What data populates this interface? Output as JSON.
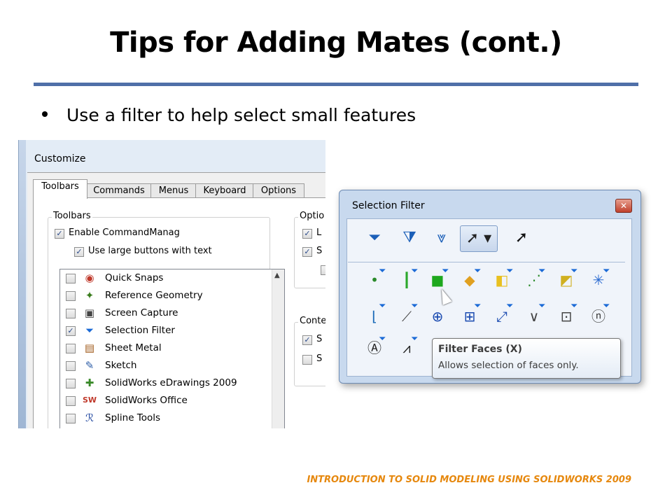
{
  "slide": {
    "title": "Tips for Adding Mates (cont.)",
    "bullet": "Use a filter to help select small features",
    "footer": "INTRODUCTION TO SOLID MODELING USING SOLIDWORKS 2009"
  },
  "customize": {
    "title": "Customize",
    "tabs": [
      "Toolbars",
      "Commands",
      "Menus",
      "Keyboard",
      "Options"
    ],
    "toolbars_group": {
      "label": "Toolbars",
      "enable_command_manager": "Enable CommandManag",
      "use_large_buttons": "Use large buttons with text"
    },
    "options_group_label": "Optio",
    "context_group_label": "Conte",
    "options_checks": [
      "L",
      "S"
    ],
    "context_checks": [
      "S",
      "S"
    ],
    "list": [
      {
        "name": "Quick Snaps",
        "checked": false,
        "icon": "quick-snaps-icon"
      },
      {
        "name": "Reference Geometry",
        "checked": false,
        "icon": "reference-geometry-icon"
      },
      {
        "name": "Screen Capture",
        "checked": false,
        "icon": "screen-capture-icon"
      },
      {
        "name": "Selection Filter",
        "checked": true,
        "icon": "selection-filter-icon"
      },
      {
        "name": "Sheet Metal",
        "checked": false,
        "icon": "sheet-metal-icon"
      },
      {
        "name": "Sketch",
        "checked": false,
        "icon": "sketch-icon"
      },
      {
        "name": "SolidWorks eDrawings 2009",
        "checked": false,
        "icon": "edrawings-icon"
      },
      {
        "name": "SolidWorks Office",
        "checked": false,
        "icon": "solidworks-office-icon"
      },
      {
        "name": "Spline Tools",
        "checked": false,
        "icon": "spline-tools-icon"
      }
    ]
  },
  "selection_filter": {
    "title": "Selection Filter",
    "tooltip_title": "Filter Faces   (X)",
    "tooltip_desc": "Allows selection of faces only."
  },
  "colors": {
    "title_rule": "#4f6fa8",
    "footer": "#e6880e",
    "funnel": "#1b6ad6"
  }
}
